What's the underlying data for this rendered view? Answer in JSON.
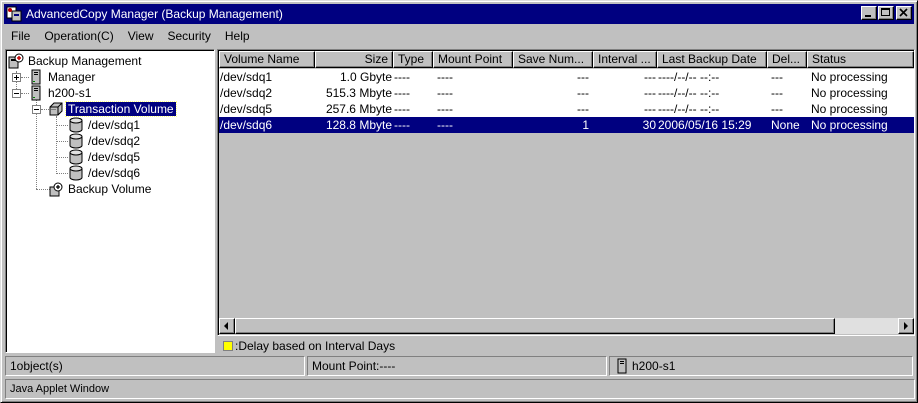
{
  "window": {
    "title": "AdvancedCopy Manager (Backup Management)",
    "title_icon": "acm-app-icon",
    "buttons": [
      "minimize",
      "maximize",
      "close"
    ]
  },
  "menu": {
    "items": [
      {
        "label": "File",
        "key": "F"
      },
      {
        "label": "Operation(C)",
        "key": "C"
      },
      {
        "label": "View",
        "key": "V"
      },
      {
        "label": "Security",
        "key": "S"
      },
      {
        "label": "Help",
        "key": "H"
      }
    ]
  },
  "tree": {
    "root": {
      "label": "Backup Management",
      "icon": "backup-management-icon"
    },
    "nodes": [
      {
        "label": "Manager",
        "icon": "server-icon",
        "expander": "plus"
      },
      {
        "label": "h200-s1",
        "icon": "server-icon",
        "expander": "minus"
      },
      {
        "label": "Transaction Volume",
        "icon": "volume-group-icon",
        "expander": "minus",
        "selected": true
      },
      {
        "label": "/dev/sdq1",
        "icon": "disk-icon"
      },
      {
        "label": "/dev/sdq2",
        "icon": "disk-icon"
      },
      {
        "label": "/dev/sdq5",
        "icon": "disk-icon"
      },
      {
        "label": "/dev/sdq6",
        "icon": "disk-icon"
      },
      {
        "label": "Backup Volume",
        "icon": "backup-volume-icon"
      }
    ]
  },
  "table": {
    "columns": [
      "Volume Name",
      "Size",
      "Type",
      "Mount Point",
      "Save Num...",
      "Interval ...",
      "Last Backup Date",
      "Del...",
      "Status"
    ],
    "rows": [
      {
        "volume": "/dev/sdq1",
        "size": "1.0 Gbyte",
        "type": "----",
        "mount": "----",
        "save": "---",
        "interval": "---",
        "last": "----/--/-- --:--",
        "delay": "---",
        "status": "No processing",
        "selected": false
      },
      {
        "volume": "/dev/sdq2",
        "size": "515.3 Mbyte",
        "type": "----",
        "mount": "----",
        "save": "---",
        "interval": "---",
        "last": "----/--/-- --:--",
        "delay": "---",
        "status": "No processing",
        "selected": false
      },
      {
        "volume": "/dev/sdq5",
        "size": "257.6 Mbyte",
        "type": "----",
        "mount": "----",
        "save": "---",
        "interval": "---",
        "last": "----/--/-- --:--",
        "delay": "---",
        "status": "No processing",
        "selected": false
      },
      {
        "volume": "/dev/sdq6",
        "size": "128.8 Mbyte",
        "type": "----",
        "mount": "----",
        "save": "1",
        "interval": "30",
        "last": "2006/05/16 15:29",
        "delay": "None",
        "status": "No processing",
        "selected": true
      }
    ]
  },
  "legend": {
    "text": ":Delay based on Interval Days",
    "color": "#ffff00"
  },
  "status": {
    "objects": "1object(s)",
    "mount_point": "Mount Point:----",
    "host": "h200-s1"
  },
  "applet": {
    "text": "Java Applet Window"
  },
  "colors": {
    "selection": "#000080",
    "titlebar": "#000080",
    "face": "#c0c0c0"
  }
}
